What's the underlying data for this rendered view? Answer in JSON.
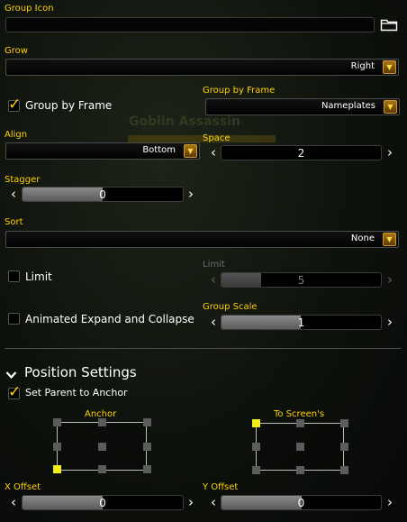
{
  "group_icon": {
    "label": "Group Icon",
    "value": ""
  },
  "grow": {
    "label": "Grow",
    "value": "Right"
  },
  "group_by_frame_toggle": {
    "label": "Group by Frame",
    "checked": true
  },
  "group_by_frame_select": {
    "label": "Group by Frame",
    "value": "Nameplates"
  },
  "background": {
    "nameplate_text": "Goblin Assassin"
  },
  "align": {
    "label": "Align",
    "value": "Bottom"
  },
  "space": {
    "label": "Space",
    "value": "2"
  },
  "stagger": {
    "label": "Stagger",
    "value": "0"
  },
  "sort": {
    "label": "Sort",
    "value": "None"
  },
  "limit_toggle": {
    "label": "Limit",
    "checked": false
  },
  "limit_slider": {
    "label": "Limit",
    "value": "5",
    "enabled": false,
    "fill": 0.3
  },
  "animated_toggle": {
    "label": "Animated Expand and Collapse",
    "checked": false
  },
  "group_scale": {
    "label": "Group Scale",
    "value": "1",
    "fill": 0.48
  },
  "position_settings": {
    "title": "Position Settings"
  },
  "set_parent": {
    "label": "Set Parent to Anchor",
    "checked": true
  },
  "anchor": {
    "label": "Anchor",
    "selected": "BOTTOMLEFT"
  },
  "to_screen": {
    "label": "To Screen's",
    "selected": "TOPLEFT"
  },
  "x_offset": {
    "label": "X Offset",
    "value": "0"
  },
  "y_offset": {
    "label": "Y Offset",
    "value": "0"
  },
  "colors": {
    "label_gold": "#ffd100",
    "anchor_selected": "#f2ee14",
    "dropdown_button": "#a87514"
  }
}
